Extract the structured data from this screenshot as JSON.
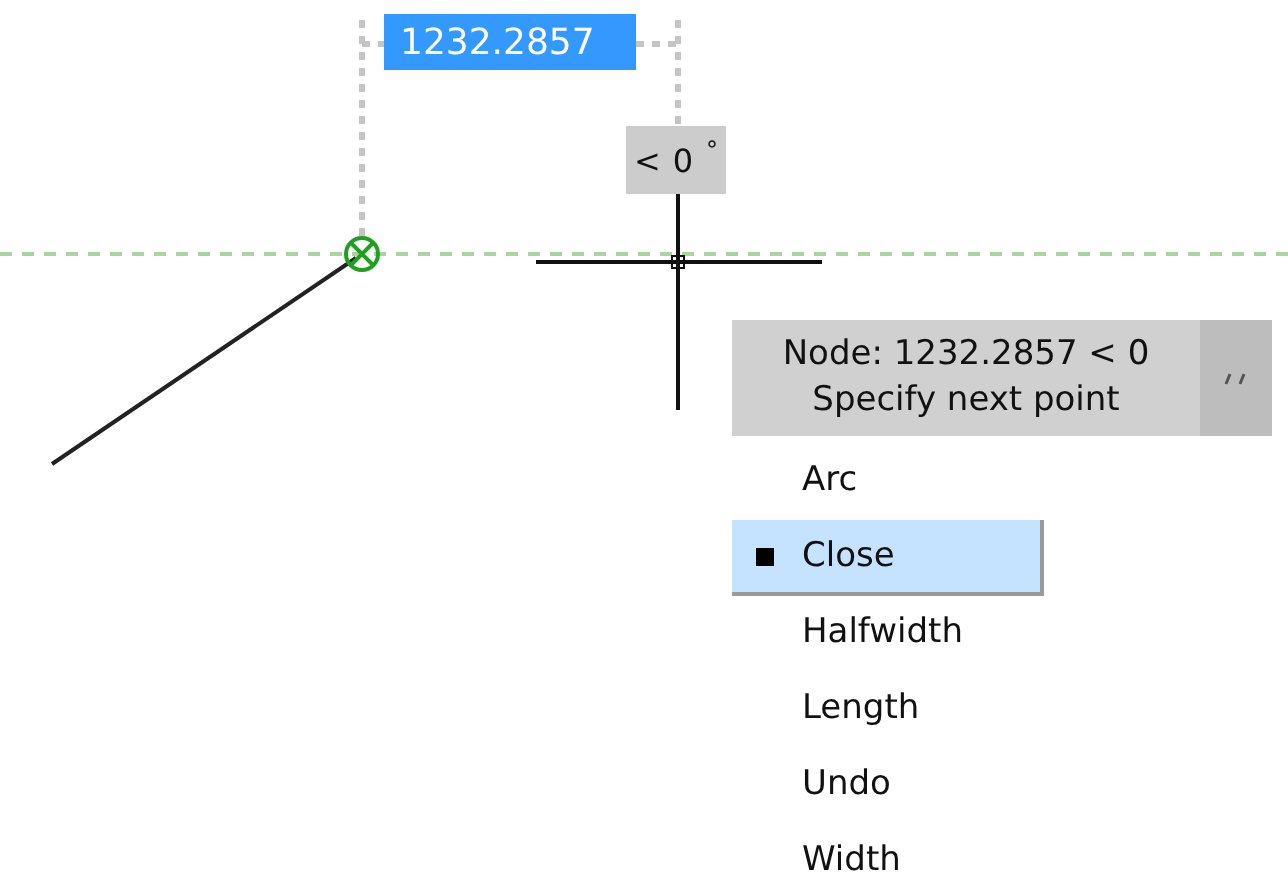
{
  "dimension_input": {
    "value": "1232.2857"
  },
  "angle_input": {
    "prefix": "<",
    "value": "0",
    "unit": "°"
  },
  "tooltip": {
    "lines": [
      "Node: 1232.2857 < 0",
      "Specify next point"
    ]
  },
  "menu": {
    "items": [
      {
        "label": "Arc",
        "selected": false
      },
      {
        "label": "Close",
        "selected": true
      },
      {
        "label": "Halfwidth",
        "selected": false
      },
      {
        "label": "Length",
        "selected": false
      },
      {
        "label": "Undo",
        "selected": false
      },
      {
        "label": "Width",
        "selected": false
      }
    ]
  }
}
